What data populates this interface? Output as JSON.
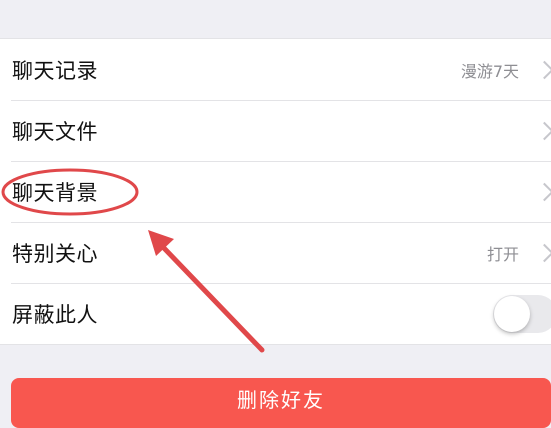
{
  "settings": {
    "items": [
      {
        "label": "聊天记录",
        "value": "漫游7天"
      },
      {
        "label": "聊天文件",
        "value": ""
      },
      {
        "label": "聊天背景",
        "value": ""
      },
      {
        "label": "特别关心",
        "value": "打开"
      },
      {
        "label": "屏蔽此人",
        "toggle_on": false
      }
    ]
  },
  "actions": {
    "delete_label": "删除好友"
  },
  "colors": {
    "background": "#efeff4",
    "delete_button": "#f8574f",
    "annotation": "#e0484a",
    "chevron": "#c7c7cc"
  },
  "icons": {
    "row_chevron": "chevron-right-icon",
    "annotation_arrow": "red-arrow-annotation"
  }
}
